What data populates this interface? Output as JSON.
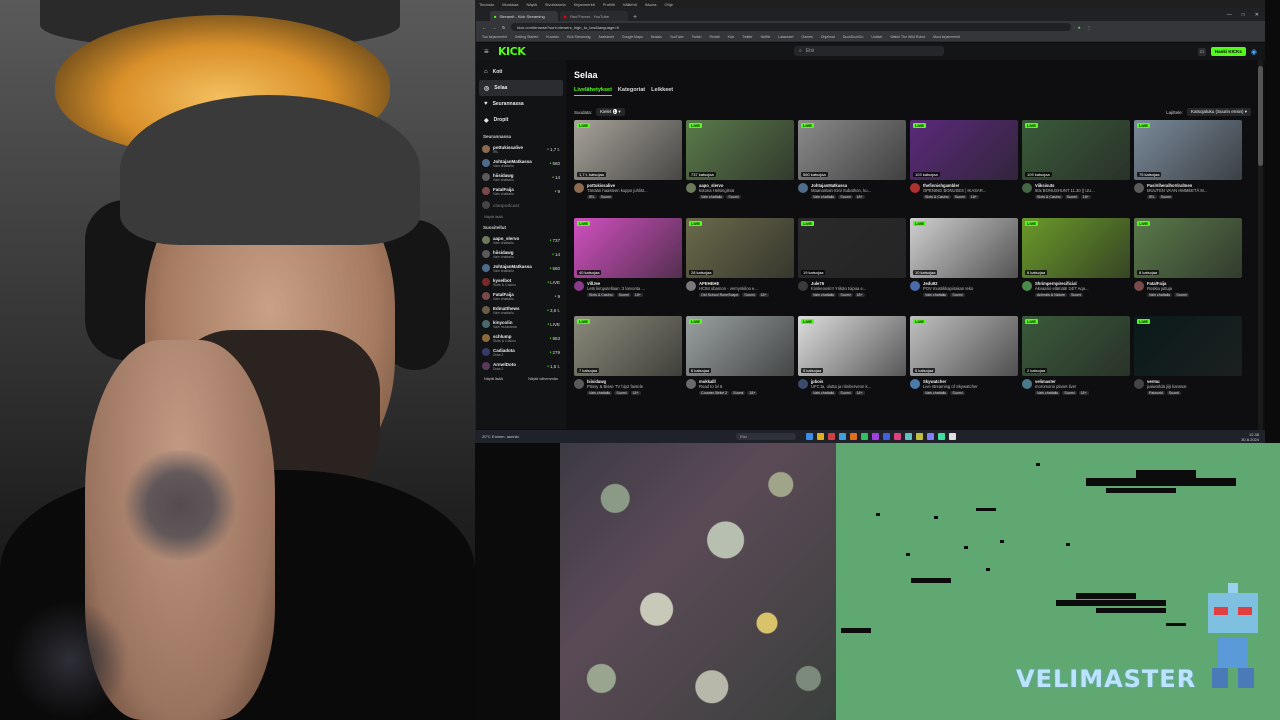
{
  "browser": {
    "menu": [
      "Tiedosto",
      "Muokkaa",
      "Näytä",
      "Sivuhistoria",
      "Kirjanmerkit",
      "Profiilit",
      "Välilehti",
      "Ikkuna",
      "Ohje"
    ],
    "tabs": [
      {
        "label": "Streamit - Kick Streaming",
        "active": true
      },
      {
        "label": "Red Forest - YouTube",
        "active": false
      }
    ],
    "address": "kick.com/browse?sort=viewers_high_to_low&language=fi",
    "bookmarks": [
      "Tuo kirjanmerkit",
      "Getting Started",
      "Kuvasto",
      "Kick Streaming",
      "Asetukset",
      "Google Maps",
      "Mosaic",
      "YouTube",
      "Twitch",
      "Reddit",
      "Kick",
      "Twitter",
      "Netflix",
      "Lataukset",
      "Games",
      "Ohjelmat",
      "DuckDuckGo",
      "Uutiset",
      "Watch The Wild Robot",
      "Muut kirjanmerkit"
    ]
  },
  "kick": {
    "logo": "KICK",
    "search_placeholder": "Etsi",
    "login_label": "Hanki KICKs",
    "nav": [
      {
        "label": "Koti",
        "icon": "home-icon",
        "active": false
      },
      {
        "label": "Selaa",
        "icon": "compass-icon",
        "active": true
      },
      {
        "label": "Seurannassa",
        "icon": "heart-icon",
        "active": false
      },
      {
        "label": "Dropit",
        "icon": "drop-icon",
        "active": false
      }
    ],
    "following_heading": "Seurannassa",
    "following": [
      {
        "name": "pottukissalive",
        "cat": "IRL",
        "count": "1,7 t.",
        "color": "#8b6a4f"
      },
      {
        "name": "JohtajanMatkassa",
        "cat": "Vain chattailu",
        "count": "560",
        "color": "#4f6a8b"
      },
      {
        "name": "hiisidawg",
        "cat": "Vain chattailu",
        "count": "14",
        "color": "#5a5a5a"
      },
      {
        "name": "FatalFaija",
        "cat": "Vain chattailu",
        "count": "9",
        "color": "#7a4a4a"
      },
      {
        "name": "clanpodcast",
        "cat": "",
        "count": "",
        "color": "#444444"
      }
    ],
    "show_more_1": "Näytä lisää",
    "recommended_heading": "Suositellut",
    "recommended": [
      {
        "name": "aapo_slervo",
        "cat": "Vain chattailu",
        "count": "737",
        "color": "#6a7a5a"
      },
      {
        "name": "hiisidawg",
        "cat": "Vain chattailu",
        "count": "14",
        "color": "#5a5a5a"
      },
      {
        "name": "JohtajanMatkassa",
        "cat": "Vain chattailu",
        "count": "560",
        "color": "#4f6a8b"
      },
      {
        "name": "kyselbot",
        "cat": "Slots & Casino",
        "count": "LIVE",
        "color": "#7a2a2a"
      },
      {
        "name": "FatalFaija",
        "cat": "Vain chattailu",
        "count": "9",
        "color": "#7a4a4a"
      },
      {
        "name": "Edmatthews",
        "cat": "Vain chattailu",
        "count": "3,6 t.",
        "color": "#6a5a4a"
      },
      {
        "name": "kinycolin",
        "cat": "Vain muutoksia",
        "count": "LIVE",
        "color": "#4a6a6a"
      },
      {
        "name": "schlump",
        "cat": "Slots & Casino",
        "count": "953",
        "color": "#8a6a3a"
      },
      {
        "name": "Cadiadota",
        "cat": "Dota 2",
        "count": "279",
        "color": "#3a3a6a"
      },
      {
        "name": "ArmelDoto",
        "cat": "Dota 2",
        "count": "1,5 t.",
        "color": "#5a3a5a"
      }
    ],
    "show_more_2": "Näytä lisää",
    "show_fewer": "Näytä vähemmän",
    "page_title": "Selaa",
    "tabs": [
      "Livelähetykset",
      "Kategoriat",
      "Leikkeet"
    ],
    "filter_label": "Suodata:",
    "filter_value": "Kielet",
    "filter_count": "1",
    "sort_label": "Lajittele:",
    "sort_value": "Katsojaluku (Suurin ensin)",
    "live_label": "LIVE",
    "streams": [
      {
        "viewers": "1,7 t. katsojaa",
        "name": "pottukissalive",
        "title": "Tänään haasteen kuppo juhlist...",
        "tags": [
          "IRL",
          "Suomi"
        ],
        "thumb": "#a6a29a",
        "av": "#8b6a4f"
      },
      {
        "viewers": "737 katsojaa",
        "name": "aapo_slervo",
        "title": "kotona Helsingissä",
        "tags": [
          "Vain chattailu",
          "Suomi"
        ],
        "thumb": "#5a7a4a",
        "av": "#6a7a5a"
      },
      {
        "viewers": "560 katsojaa",
        "name": "JohtajanMatkassa",
        "title": "Maanantain mini Subathon, ku...",
        "tags": [
          "Vain chattailu",
          "Suomi",
          "18+"
        ],
        "thumb": "#8a8a8a",
        "av": "#4f6a8b"
      },
      {
        "viewers": "103 katsojaa",
        "name": "thefinnishgambler",
        "title": "OPENING BONUSES | IKASAR...",
        "tags": [
          "Slots & Casino",
          "Suomi",
          "18+"
        ],
        "thumb": "#5a2a7a",
        "av": "#b03030"
      },
      {
        "viewers": "109 katsojaa",
        "name": "Viiksisuts",
        "title": "50x BONUSHUNT 11.30 || UU...",
        "tags": [
          "Slots & Casino",
          "Suomi",
          "18+"
        ],
        "thumb": "#3a5a3a",
        "av": "#446644"
      },
      {
        "viewers": "75 katsojaa",
        "name": "PasiViheralhoViralInen",
        "title": "MUUTEN VAAN HMMEETÄ M...",
        "tags": [
          "IRL",
          "Suomi"
        ],
        "thumb": "#7a8a9a",
        "av": "#5a5a5a"
      },
      {
        "viewers": "40 katsojaa",
        "name": "VillJee",
        "title": "Lets kimputellaan :3 larvonta ...",
        "tags": [
          "Slots & Casino",
          "Suomi",
          "18+"
        ],
        "thumb": "#d050c0",
        "av": "#8a3a8a"
      },
      {
        "viewers": "28 katsojaa",
        "name": "APEHEHE",
        "title": "HCIM obamon - vernynkiloo e...",
        "tags": [
          "Old School RuneScape",
          "Suomi",
          "18+"
        ],
        "thumb": "#6a6a4a",
        "av": "#7a7a7a"
      },
      {
        "viewers": "19 katsojaa",
        "name": "Jule75",
        "title": "Koskeoosi!!! Yrikän toipua e...",
        "tags": [
          "Vain chattailu",
          "Suomi",
          "18+"
        ],
        "thumb": "#2a2a2a",
        "av": "#3a3a3a"
      },
      {
        "viewers": "10 katsojaa",
        "name": "Jedu92",
        "title": "POV mustikkapiirakan teko",
        "tags": [
          "Vain chattailu",
          "Suomi"
        ],
        "thumb": "#cfcfcf",
        "av": "#4a6aaa"
      },
      {
        "viewers": "6 katsojaa",
        "name": "Shrimpernpirecificial",
        "title": "Akvaario elämää! 24/7 Aqu...",
        "tags": [
          "Animals & Nature",
          "Suomi"
        ],
        "thumb": "#6a9a2a",
        "av": "#4a8a4a"
      },
      {
        "viewers": "8 katsojaa",
        "name": "FatalFaija",
        "title": "Roskia juttuja",
        "tags": [
          "Vain chattailu",
          "Suomi"
        ],
        "thumb": "#5a7a4a",
        "av": "#7a4a4a"
      },
      {
        "viewers": "7 katsojaa",
        "name": "hiisidawg",
        "title": "Pössy & Bisse TV hip2 fantele",
        "tags": [
          "Vain chattailu",
          "Suomi",
          "18+"
        ],
        "thumb": "#8a8a7a",
        "av": "#5a5a5a"
      },
      {
        "viewers": "6 katsojaa",
        "name": "mokkalll",
        "title": "Road to lvl 6",
        "tags": [
          "Counter-Strike 2",
          "Suomi",
          "18+"
        ],
        "thumb": "#9aa0a0",
        "av": "#6a6a6a"
      },
      {
        "viewers": "5 katsojaa",
        "name": "jpbois",
        "title": "UFC:ta, olutta ja riimbervenn k...",
        "tags": [
          "Vain chattailu",
          "Suomi",
          "18+"
        ],
        "thumb": "#ddd",
        "av": "#3a4a6a"
      },
      {
        "viewers": "5 katsojaa",
        "name": "Skywatcher",
        "title": "Live streaming of Skywatcher",
        "tags": [
          "Vain chattailu",
          "Suomi"
        ],
        "thumb": "#c0c0c0",
        "av": "#4a7aaa"
      },
      {
        "viewers": "2 katsojaa",
        "name": "velimaster",
        "title": "moromoroi planet live!",
        "tags": [
          "Vain chattailu",
          "Suomi",
          "18+"
        ],
        "thumb": "#3a5a3a",
        "av": "#4a7a8a"
      },
      {
        "viewers": "",
        "name": "vermu",
        "title": "paiworldä jiijt kanssa!",
        "tags": [
          "Palworld",
          "Suomi"
        ],
        "thumb": "#0a1a1a",
        "av": "#444"
      }
    ]
  },
  "taskbar": {
    "weather": "20°C Enimm. aurinki.",
    "search_placeholder": "Etsi",
    "time": "12.38",
    "date": "30.8.2024"
  },
  "overlay": {
    "brand": "VELIMASTER"
  },
  "colors": {
    "kick_green": "#53fc18",
    "game_green": "#5fa872"
  }
}
